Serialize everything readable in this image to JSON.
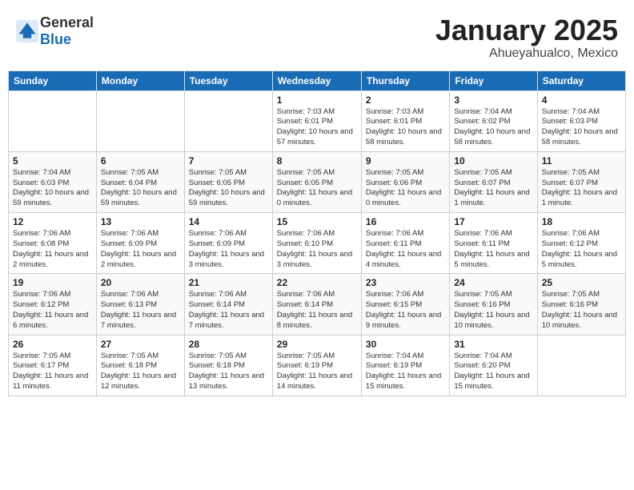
{
  "header": {
    "logo": {
      "text_general": "General",
      "text_blue": "Blue"
    },
    "month": "January 2025",
    "location": "Ahueyahualco, Mexico"
  },
  "weekdays": [
    "Sunday",
    "Monday",
    "Tuesday",
    "Wednesday",
    "Thursday",
    "Friday",
    "Saturday"
  ],
  "weeks": [
    [
      {
        "day": "",
        "info": ""
      },
      {
        "day": "",
        "info": ""
      },
      {
        "day": "",
        "info": ""
      },
      {
        "day": "1",
        "info": "Sunrise: 7:03 AM\nSunset: 6:01 PM\nDaylight: 10 hours and 57 minutes."
      },
      {
        "day": "2",
        "info": "Sunrise: 7:03 AM\nSunset: 6:01 PM\nDaylight: 10 hours and 58 minutes."
      },
      {
        "day": "3",
        "info": "Sunrise: 7:04 AM\nSunset: 6:02 PM\nDaylight: 10 hours and 58 minutes."
      },
      {
        "day": "4",
        "info": "Sunrise: 7:04 AM\nSunset: 6:03 PM\nDaylight: 10 hours and 58 minutes."
      }
    ],
    [
      {
        "day": "5",
        "info": "Sunrise: 7:04 AM\nSunset: 6:03 PM\nDaylight: 10 hours and 59 minutes."
      },
      {
        "day": "6",
        "info": "Sunrise: 7:05 AM\nSunset: 6:04 PM\nDaylight: 10 hours and 59 minutes."
      },
      {
        "day": "7",
        "info": "Sunrise: 7:05 AM\nSunset: 6:05 PM\nDaylight: 10 hours and 59 minutes."
      },
      {
        "day": "8",
        "info": "Sunrise: 7:05 AM\nSunset: 6:05 PM\nDaylight: 11 hours and 0 minutes."
      },
      {
        "day": "9",
        "info": "Sunrise: 7:05 AM\nSunset: 6:06 PM\nDaylight: 11 hours and 0 minutes."
      },
      {
        "day": "10",
        "info": "Sunrise: 7:05 AM\nSunset: 6:07 PM\nDaylight: 11 hours and 1 minute."
      },
      {
        "day": "11",
        "info": "Sunrise: 7:05 AM\nSunset: 6:07 PM\nDaylight: 11 hours and 1 minute."
      }
    ],
    [
      {
        "day": "12",
        "info": "Sunrise: 7:06 AM\nSunset: 6:08 PM\nDaylight: 11 hours and 2 minutes."
      },
      {
        "day": "13",
        "info": "Sunrise: 7:06 AM\nSunset: 6:09 PM\nDaylight: 11 hours and 2 minutes."
      },
      {
        "day": "14",
        "info": "Sunrise: 7:06 AM\nSunset: 6:09 PM\nDaylight: 11 hours and 3 minutes."
      },
      {
        "day": "15",
        "info": "Sunrise: 7:06 AM\nSunset: 6:10 PM\nDaylight: 11 hours and 3 minutes."
      },
      {
        "day": "16",
        "info": "Sunrise: 7:06 AM\nSunset: 6:11 PM\nDaylight: 11 hours and 4 minutes."
      },
      {
        "day": "17",
        "info": "Sunrise: 7:06 AM\nSunset: 6:11 PM\nDaylight: 11 hours and 5 minutes."
      },
      {
        "day": "18",
        "info": "Sunrise: 7:06 AM\nSunset: 6:12 PM\nDaylight: 11 hours and 5 minutes."
      }
    ],
    [
      {
        "day": "19",
        "info": "Sunrise: 7:06 AM\nSunset: 6:12 PM\nDaylight: 11 hours and 6 minutes."
      },
      {
        "day": "20",
        "info": "Sunrise: 7:06 AM\nSunset: 6:13 PM\nDaylight: 11 hours and 7 minutes."
      },
      {
        "day": "21",
        "info": "Sunrise: 7:06 AM\nSunset: 6:14 PM\nDaylight: 11 hours and 7 minutes."
      },
      {
        "day": "22",
        "info": "Sunrise: 7:06 AM\nSunset: 6:14 PM\nDaylight: 11 hours and 8 minutes."
      },
      {
        "day": "23",
        "info": "Sunrise: 7:06 AM\nSunset: 6:15 PM\nDaylight: 11 hours and 9 minutes."
      },
      {
        "day": "24",
        "info": "Sunrise: 7:05 AM\nSunset: 6:16 PM\nDaylight: 11 hours and 10 minutes."
      },
      {
        "day": "25",
        "info": "Sunrise: 7:05 AM\nSunset: 6:16 PM\nDaylight: 11 hours and 10 minutes."
      }
    ],
    [
      {
        "day": "26",
        "info": "Sunrise: 7:05 AM\nSunset: 6:17 PM\nDaylight: 11 hours and 11 minutes."
      },
      {
        "day": "27",
        "info": "Sunrise: 7:05 AM\nSunset: 6:18 PM\nDaylight: 11 hours and 12 minutes."
      },
      {
        "day": "28",
        "info": "Sunrise: 7:05 AM\nSunset: 6:18 PM\nDaylight: 11 hours and 13 minutes."
      },
      {
        "day": "29",
        "info": "Sunrise: 7:05 AM\nSunset: 6:19 PM\nDaylight: 11 hours and 14 minutes."
      },
      {
        "day": "30",
        "info": "Sunrise: 7:04 AM\nSunset: 6:19 PM\nDaylight: 11 hours and 15 minutes."
      },
      {
        "day": "31",
        "info": "Sunrise: 7:04 AM\nSunset: 6:20 PM\nDaylight: 11 hours and 15 minutes."
      },
      {
        "day": "",
        "info": ""
      }
    ]
  ]
}
